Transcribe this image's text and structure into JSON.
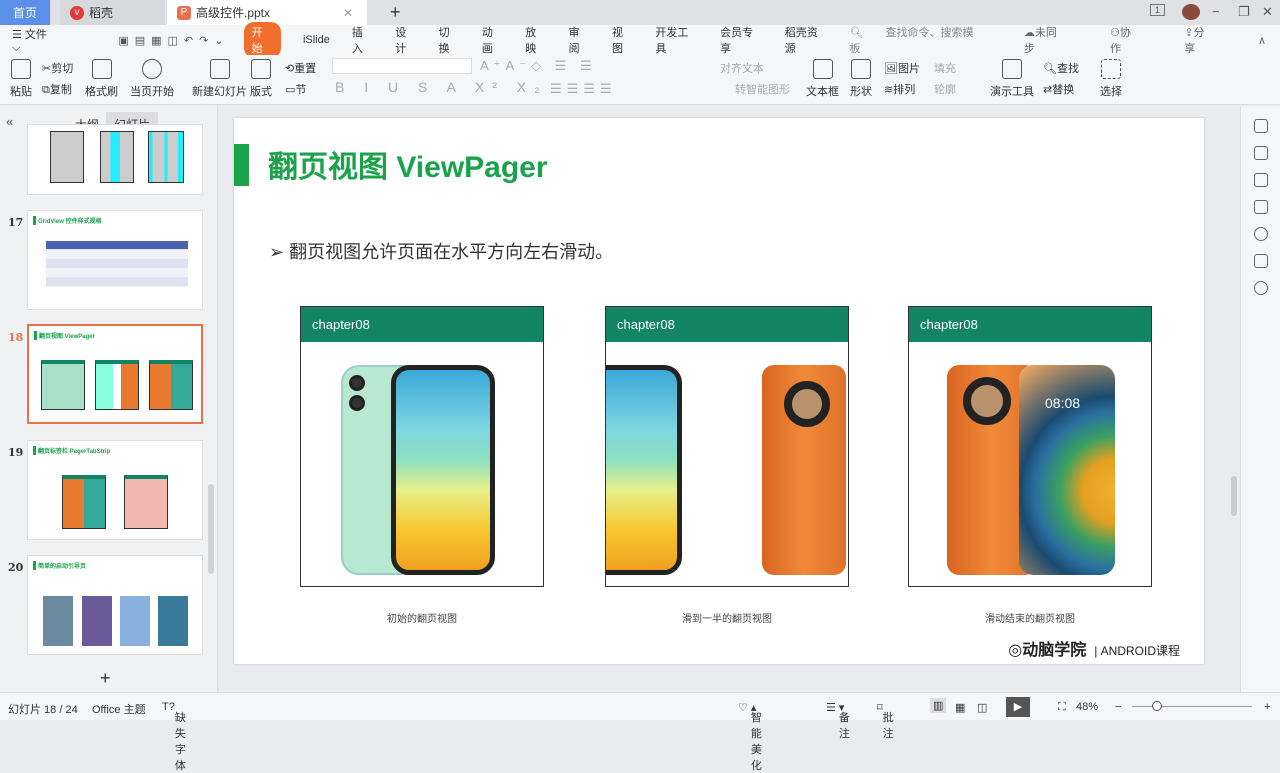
{
  "tabs": {
    "home": "首页",
    "daoke": "稻壳",
    "doc": "高级控件.pptx",
    "new_tab": "+"
  },
  "window": {
    "minimize": "−",
    "restore": "❐",
    "close": "✕",
    "page_num": "1"
  },
  "menu": {
    "file": "文件",
    "items": [
      "开始",
      "iSlide",
      "插入",
      "设计",
      "切换",
      "动画",
      "放映",
      "审阅",
      "视图",
      "开发工具",
      "会员专享",
      "稻壳资源"
    ],
    "search_placeholder": "查找命令、搜索模板",
    "sync": "未同步",
    "collab": "协作",
    "share": "分享"
  },
  "ribbon": {
    "paste": "粘贴",
    "cut": "剪切",
    "copy": "复制",
    "format_painter": "格式刷",
    "play_current": "当页开始",
    "new_slide": "新建幻灯片",
    "layout": "版式",
    "reset": "重置",
    "section": "节",
    "align_text": "对齐文本",
    "smart_shape": "转智能图形",
    "textbox": "文本框",
    "shape": "形状",
    "picture": "图片",
    "fill": "填充",
    "arrange": "排列",
    "outline": "轮廓",
    "presenter_tools": "演示工具",
    "find": "查找",
    "replace": "替换",
    "select": "选择"
  },
  "panel": {
    "outline_tab": "大纲",
    "slides_tab": "幻灯片",
    "add": "+",
    "thumbs": [
      {
        "num": "",
        "title": ""
      },
      {
        "num": "17",
        "title": "GridView 控件样式规格"
      },
      {
        "num": "18",
        "title": "翻页视图 ViewPager"
      },
      {
        "num": "19",
        "title": "翻页标签栏 PagerTabStrip"
      },
      {
        "num": "20",
        "title": "简单的启动引导页"
      }
    ]
  },
  "slide": {
    "title": "翻页视图 ViewPager",
    "bullet": "➢ 翻页视图允许页面在水平方向左右滑动。",
    "cards": [
      {
        "header": "chapter08",
        "caption": "初始的翻页视图"
      },
      {
        "header": "chapter08",
        "caption": "滑到一半的翻页视图"
      },
      {
        "header": "chapter08",
        "caption": "滑动结束的翻页视图"
      }
    ],
    "logo": "动脑学院",
    "logo_sub": "| ANDROID课程",
    "clock": "08:08"
  },
  "status": {
    "slide_count": "幻灯片 18 / 24",
    "theme": "Office 主题",
    "missing_font": "缺失字体",
    "beautify": "智能美化",
    "notes": "备注",
    "comment": "批注",
    "zoom": "48%"
  },
  "colors": {
    "accent": "#1aa34a",
    "header": "#138466",
    "tab_active": "#f06e2e"
  }
}
